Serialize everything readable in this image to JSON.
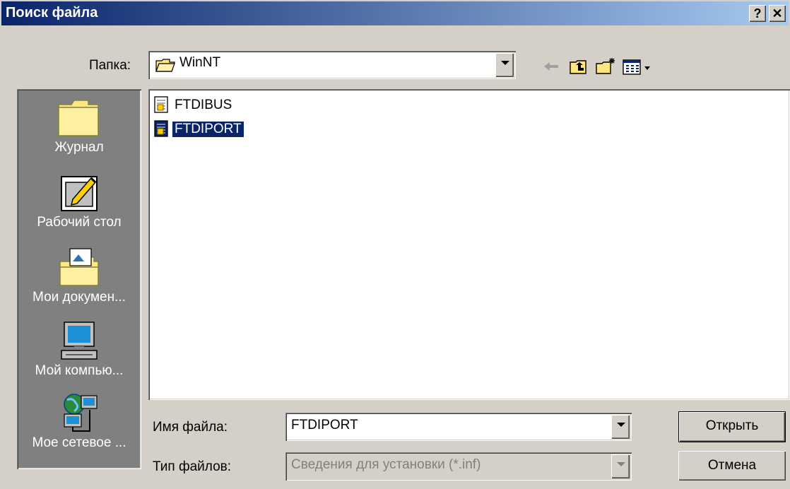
{
  "window": {
    "title": "Поиск файла",
    "help_button": "?",
    "close_button": "✕"
  },
  "toolbar": {
    "folder_label": "Папка:",
    "folder_value": "WinNT",
    "icons": [
      "back-arrow-icon",
      "up-folder-icon",
      "new-folder-icon",
      "view-menu-icon"
    ]
  },
  "places": [
    {
      "label": "Журнал",
      "icon": "history-folder-icon"
    },
    {
      "label": "Рабочий стол",
      "icon": "desktop-icon"
    },
    {
      "label": "Мои докумен...",
      "icon": "my-documents-icon"
    },
    {
      "label": "Мой компью...",
      "icon": "my-computer-icon"
    },
    {
      "label": "Мое сетевое ...",
      "icon": "network-places-icon"
    }
  ],
  "files": [
    {
      "name": "FTDIBUS",
      "selected": false,
      "icon": "inf-file-icon"
    },
    {
      "name": "FTDIPORT",
      "selected": true,
      "icon": "inf-file-icon"
    }
  ],
  "form": {
    "filename_label": "Имя файла:",
    "filename_value": "FTDIPORT",
    "filetype_label": "Тип файлов:",
    "filetype_value": "Сведения для установки (*.inf)"
  },
  "buttons": {
    "open": "Открыть",
    "cancel": "Отмена"
  },
  "colors": {
    "title_bar_start": "#0a246a",
    "title_bar_end": "#a6caf0",
    "dialog_face": "#d4d0c8",
    "places_bar": "#808080",
    "selection": "#0a246a"
  }
}
